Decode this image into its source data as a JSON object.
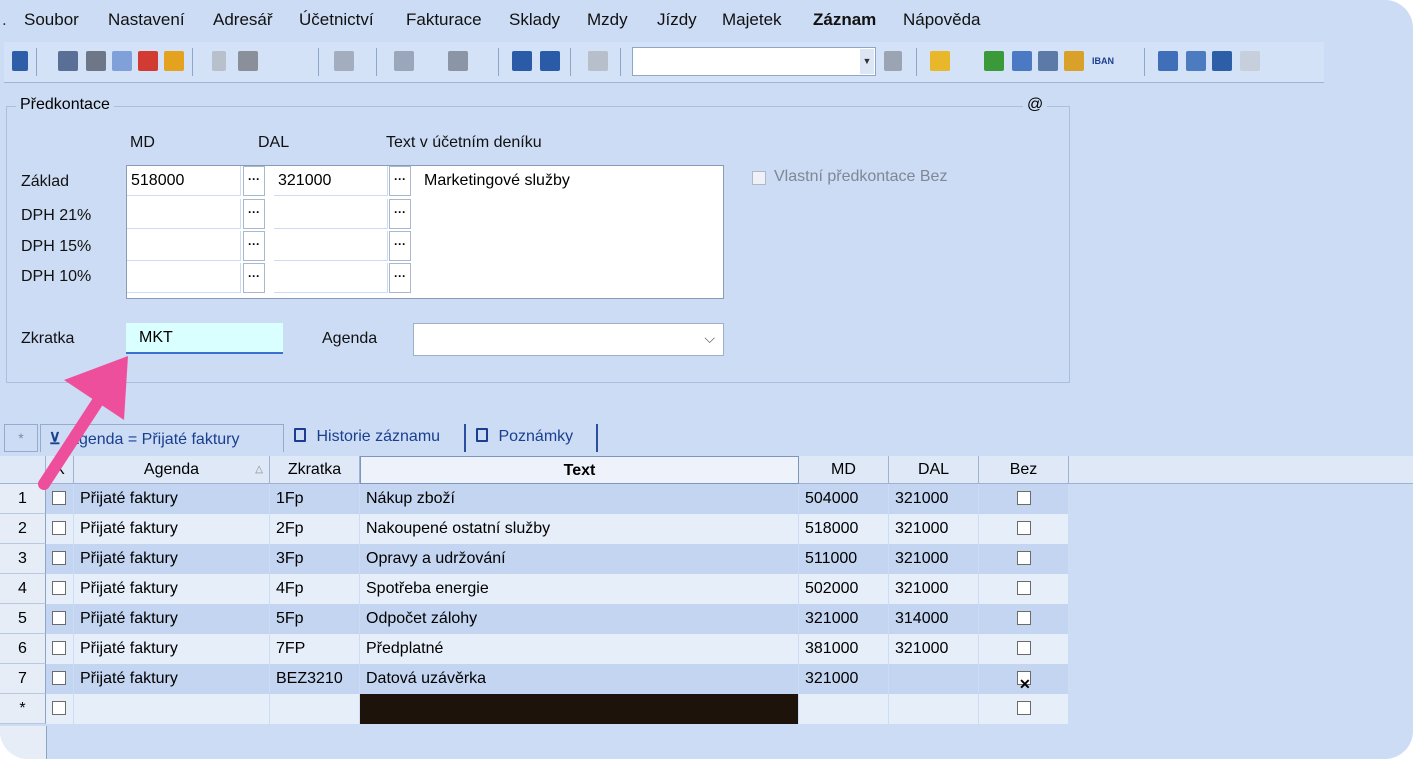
{
  "menu": [
    "Soubor",
    "Nastavení",
    "Adresář",
    "Účetnictví",
    "Fakturace",
    "Sklady",
    "Mzdy",
    "Jízdy",
    "Majetek",
    "Záznam",
    "Nápověda"
  ],
  "toolbar": {
    "combo_value": "",
    "iban_label": "IBAN"
  },
  "group": {
    "title": "Předkontace",
    "at_symbol": "@",
    "col_md": "MD",
    "col_dal": "DAL",
    "col_text": "Text v účetním deníku",
    "rows": [
      {
        "label": "Základ",
        "md": "518000",
        "dal": "321000"
      },
      {
        "label": "DPH 21%",
        "md": "",
        "dal": ""
      },
      {
        "label": "DPH 15%",
        "md": "",
        "dal": ""
      },
      {
        "label": "DPH 10%",
        "md": "",
        "dal": ""
      }
    ],
    "text_value": "Marketingové služby",
    "own_checkbox_label": "Vlastní předkontace Bez",
    "zkratka_label": "Zkratka",
    "zkratka_value": "MKT",
    "agenda_label": "Agenda",
    "agenda_value": ""
  },
  "tabs": [
    {
      "label": "Agenda = Přijaté faktury",
      "icon": "filter-icon"
    },
    {
      "label": "Historie záznamu",
      "icon": "document-icon"
    },
    {
      "label": "Poznámky",
      "icon": "document-icon"
    }
  ],
  "grid": {
    "headers": {
      "x": "X",
      "agenda": "Agenda",
      "zkratka": "Zkratka",
      "text": "Text",
      "md": "MD",
      "dal": "DAL",
      "bez": "Bez"
    },
    "rows": [
      {
        "n": "1",
        "agenda": "Přijaté faktury",
        "zkratka": "1Fp",
        "text": "Nákup zboží",
        "md": "504000",
        "dal": "321000",
        "bez": false
      },
      {
        "n": "2",
        "agenda": "Přijaté faktury",
        "zkratka": "2Fp",
        "text": "Nakoupené ostatní služby",
        "md": "518000",
        "dal": "321000",
        "bez": false
      },
      {
        "n": "3",
        "agenda": "Přijaté faktury",
        "zkratka": "3Fp",
        "text": "Opravy a udržování",
        "md": "511000",
        "dal": "321000",
        "bez": false
      },
      {
        "n": "4",
        "agenda": "Přijaté faktury",
        "zkratka": "4Fp",
        "text": "Spotřeba energie",
        "md": "502000",
        "dal": "321000",
        "bez": false
      },
      {
        "n": "5",
        "agenda": "Přijaté faktury",
        "zkratka": "5Fp",
        "text": "Odpočet zálohy",
        "md": "321000",
        "dal": "314000",
        "bez": false
      },
      {
        "n": "6",
        "agenda": "Přijaté faktury",
        "zkratka": "7FP",
        "text": "Předplatné",
        "md": "381000",
        "dal": "321000",
        "bez": false
      },
      {
        "n": "7",
        "agenda": "Přijaté faktury",
        "zkratka": "BEZ3210",
        "text": "Datová uzávěrka",
        "md": "321000",
        "dal": "",
        "bez": true
      }
    ],
    "new_row_marker": "*"
  },
  "tab_star": "*",
  "colors": {
    "highlight_arrow": "#ee4f9c",
    "accent": "#1a3f8f"
  }
}
